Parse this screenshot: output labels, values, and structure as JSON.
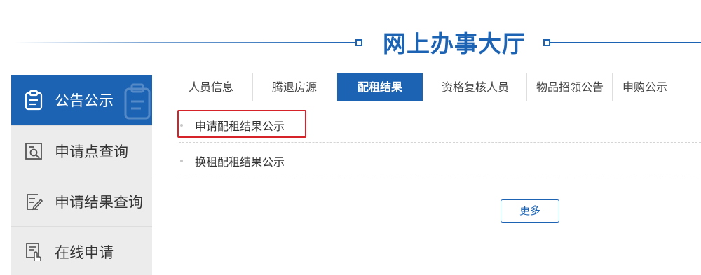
{
  "header": {
    "title": "网上办事大厅"
  },
  "sidebar": {
    "items": [
      {
        "label": "公告公示",
        "icon": "clipboard-icon",
        "active": true
      },
      {
        "label": "申请点查询",
        "icon": "search-document-icon",
        "active": false
      },
      {
        "label": "申请结果查询",
        "icon": "edit-document-icon",
        "active": false
      },
      {
        "label": "在线申请",
        "icon": "touch-document-icon",
        "active": false
      }
    ]
  },
  "tabs": [
    {
      "label": "人员信息",
      "active": false
    },
    {
      "label": "腾退房源",
      "active": false
    },
    {
      "label": "配租结果",
      "active": true
    },
    {
      "label": "资格复核人员",
      "active": false
    },
    {
      "label": "物品招领公告",
      "active": false
    },
    {
      "label": "申购公示",
      "active": false
    }
  ],
  "list": [
    {
      "text": "申请配租结果公示",
      "highlighted": true
    },
    {
      "text": "换租配租结果公示",
      "highlighted": false
    }
  ],
  "more_button": "更多",
  "colors": {
    "accent": "#1c63b4",
    "highlight": "#d6232a",
    "sidebar_bg": "#ececec"
  }
}
